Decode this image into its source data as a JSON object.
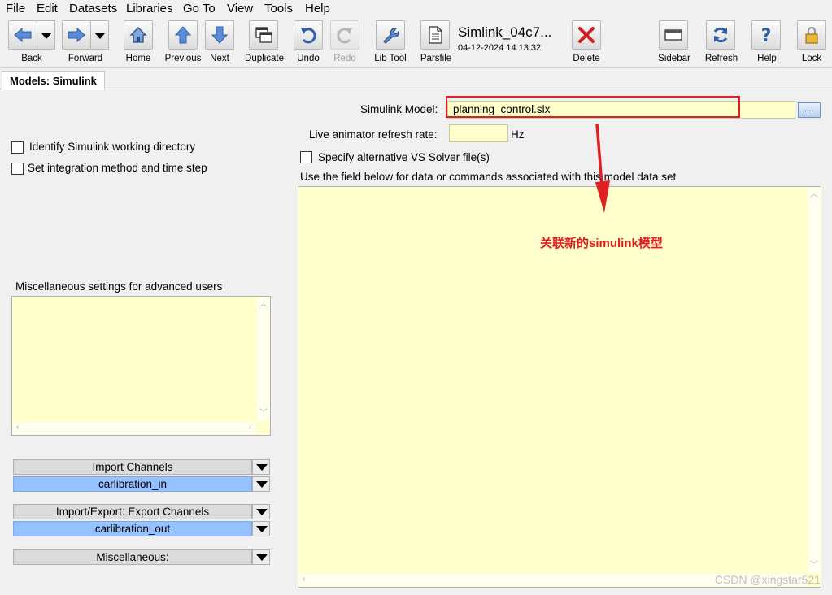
{
  "menu": [
    "File",
    "Edit",
    "Datasets",
    "Libraries",
    "Go To",
    "View",
    "Tools",
    "Help"
  ],
  "toolbar": {
    "back": "Back",
    "forward": "Forward",
    "home": "Home",
    "previous": "Previous",
    "next": "Next",
    "duplicate": "Duplicate",
    "undo": "Undo",
    "redo": "Redo",
    "lib_tool": "Lib Tool",
    "parsfile": "Parsfile",
    "delete": "Delete",
    "sidebar": "Sidebar",
    "refresh": "Refresh",
    "help": "Help",
    "lock": "Lock"
  },
  "document": {
    "title": "Simlink_04c7...",
    "date": "04-12-2024 14:13:32"
  },
  "tabs": [
    "Models: Simulink"
  ],
  "form": {
    "simulink_model_label": "Simulink Model:",
    "simulink_model_value": "planning_control.slx",
    "browse_label": "....",
    "refresh_rate_label": "Live animator refresh rate:",
    "refresh_rate_value": "",
    "refresh_rate_unit": "Hz",
    "identify_dir_label": "Identify Simulink working directory",
    "integration_label": "Set integration method and time step",
    "alt_solver_label": "Specify alternative VS Solver file(s)",
    "commands_label": "Use the field below  for data or commands associated with this model data set",
    "misc_label": "Miscellaneous settings for advanced users"
  },
  "dropdowns": {
    "import_channels": {
      "header": "Import Channels",
      "value": "carlibration_in"
    },
    "export_channels": {
      "header": "Import/Export: Export Channels",
      "value": "carlibration_out"
    },
    "miscellaneous": {
      "header": "Miscellaneous:"
    }
  },
  "annotation": {
    "text": "关联新的simulink模型",
    "color": "#e02020"
  },
  "watermark": "CSDN @xingstar521",
  "colors": {
    "field_bg": "#ffffcc",
    "selected_bg": "#96c3ff",
    "annotation": "#e02020"
  }
}
